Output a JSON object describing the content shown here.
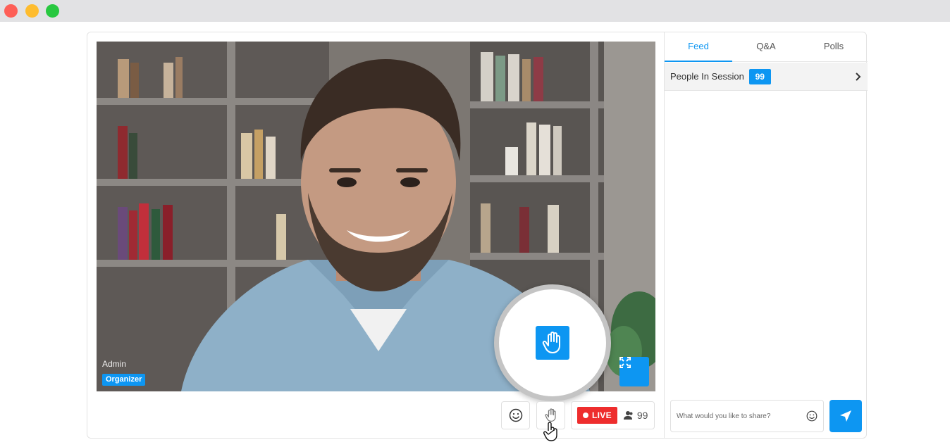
{
  "window": {
    "controls": [
      "close",
      "minimize",
      "maximize"
    ]
  },
  "video": {
    "presenter_name": "Admin",
    "role_badge": "Organizer",
    "fullscreen_icon": "expand-icon"
  },
  "magnifier": {
    "icon": "raise-hand-icon"
  },
  "controls": {
    "emoji_icon": "smiley-icon",
    "hand_icon": "raise-hand-icon",
    "live_label": "LIVE",
    "viewer_count": "99",
    "viewer_icon": "people-icon"
  },
  "panel": {
    "tabs": [
      {
        "label": "Feed",
        "active": true
      },
      {
        "label": "Q&A",
        "active": false
      },
      {
        "label": "Polls",
        "active": false
      }
    ],
    "people_label": "People In Session",
    "people_count": "99",
    "compose_placeholder": "What would you like to share?",
    "compose_value": ""
  },
  "colors": {
    "accent": "#0d96f2",
    "live": "#ee2d2d"
  }
}
